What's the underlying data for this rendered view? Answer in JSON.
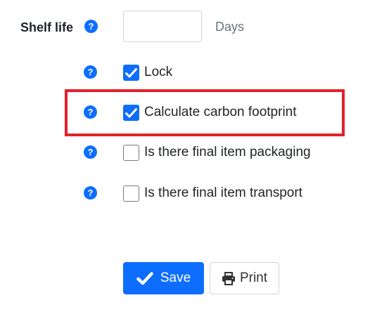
{
  "shelf_life": {
    "label": "Shelf life",
    "help_glyph": "?",
    "value": "",
    "unit": "Days"
  },
  "options": [
    {
      "label": "Lock",
      "checked": true,
      "help_glyph": "?"
    },
    {
      "label": "Calculate carbon footprint",
      "checked": true,
      "help_glyph": "?",
      "highlighted": true
    },
    {
      "label": "Is there final item packaging",
      "checked": false,
      "help_glyph": "?"
    },
    {
      "label": "Is there final item transport",
      "checked": false,
      "help_glyph": "?"
    }
  ],
  "actions": {
    "save_label": "Save",
    "save_icon": "checkmark-icon",
    "print_label": "Print",
    "print_icon": "printer-icon"
  },
  "colors": {
    "primary": "#0d6efd",
    "highlight": "#e3202b"
  }
}
